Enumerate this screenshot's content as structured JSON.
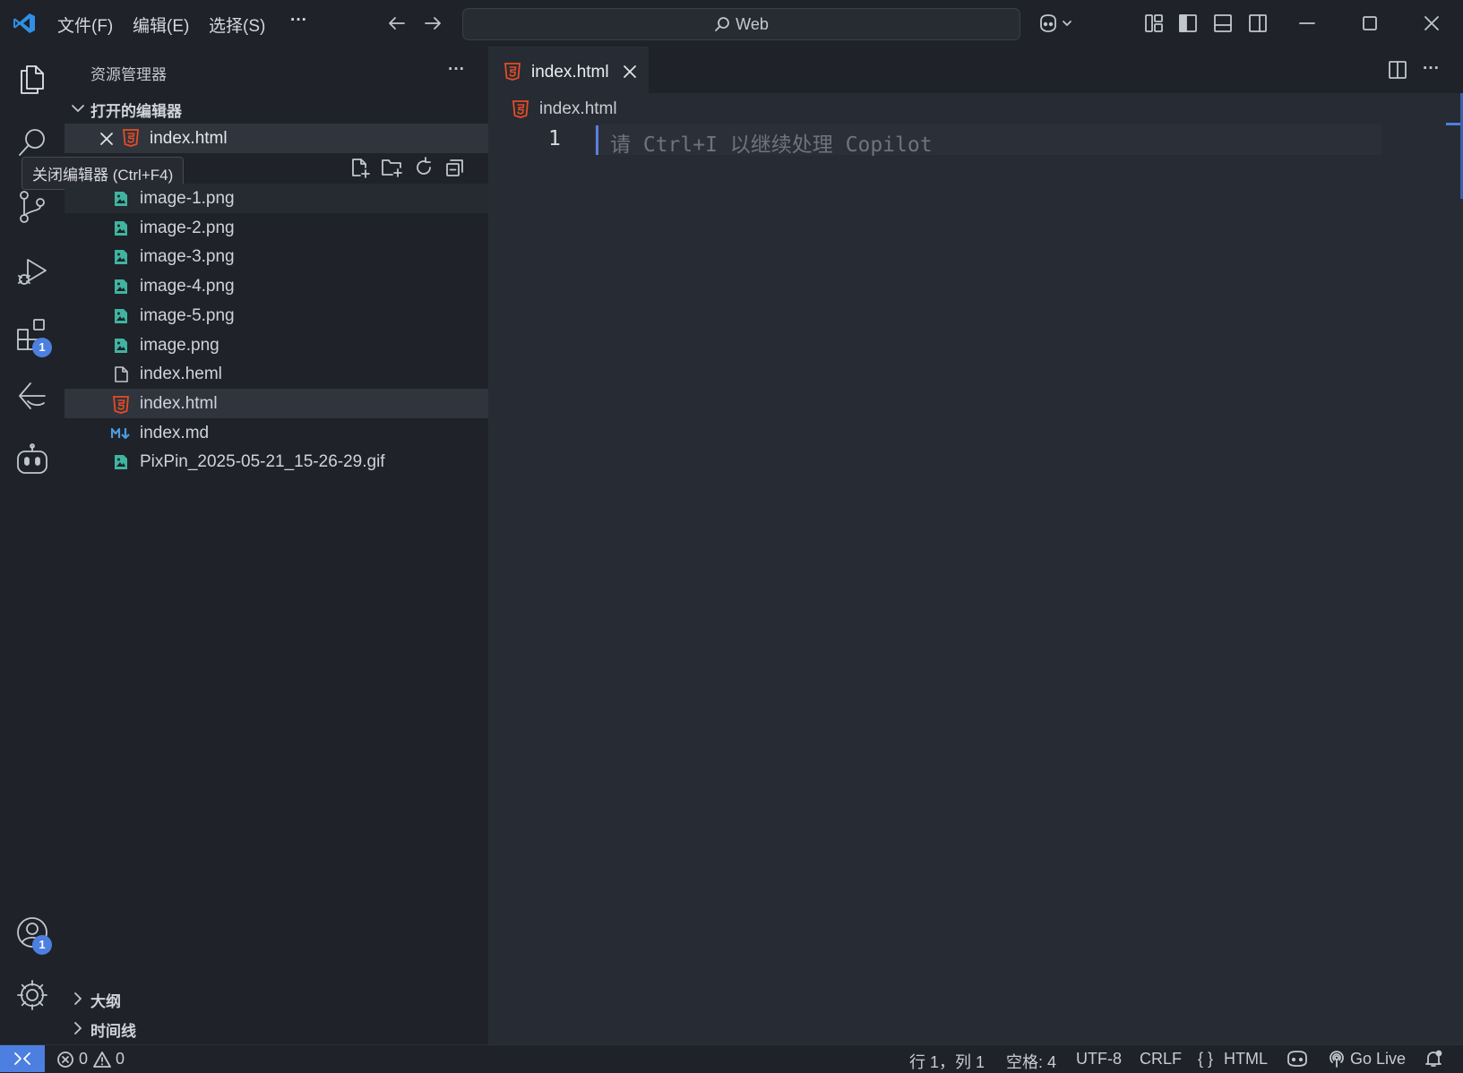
{
  "titlebar": {
    "menus": [
      "文件(F)",
      "编辑(E)",
      "选择(S)",
      "···"
    ],
    "search_text": "Web"
  },
  "activity": {
    "extensions_badge": "1",
    "accounts_badge": "1"
  },
  "explorer": {
    "title": "资源管理器",
    "more": "···",
    "open_editors_header": "打开的编辑器",
    "open_editor_file": "index.html",
    "tooltip": "关闭编辑器 (Ctrl+F4)",
    "files": [
      {
        "name": "image-1.png",
        "type": "image"
      },
      {
        "name": "image-2.png",
        "type": "image"
      },
      {
        "name": "image-3.png",
        "type": "image"
      },
      {
        "name": "image-4.png",
        "type": "image"
      },
      {
        "name": "image-5.png",
        "type": "image"
      },
      {
        "name": "image.png",
        "type": "image"
      },
      {
        "name": "index.heml",
        "type": "file"
      },
      {
        "name": "index.html",
        "type": "html"
      },
      {
        "name": "index.md",
        "type": "markdown"
      },
      {
        "name": "PixPin_2025-05-21_15-26-29.gif",
        "type": "image"
      }
    ],
    "outline": "大纲",
    "timeline": "时间线"
  },
  "editor": {
    "tab_label": "index.html",
    "breadcrumb": "index.html",
    "line_number": "1",
    "placeholder": "请 Ctrl+I 以继续处理 Copilot"
  },
  "statusbar": {
    "errors": "0",
    "warnings": "0",
    "position": "行 1，列 1",
    "spaces": "空格: 4",
    "encoding": "UTF-8",
    "eol": "CRLF",
    "language": "HTML",
    "golive": "Go Live"
  },
  "colors": {
    "accent": "#4c7fe0",
    "html_icon": "#e44d26",
    "image_icon": "#3fb4a0",
    "md_icon": "#4d9be0"
  }
}
